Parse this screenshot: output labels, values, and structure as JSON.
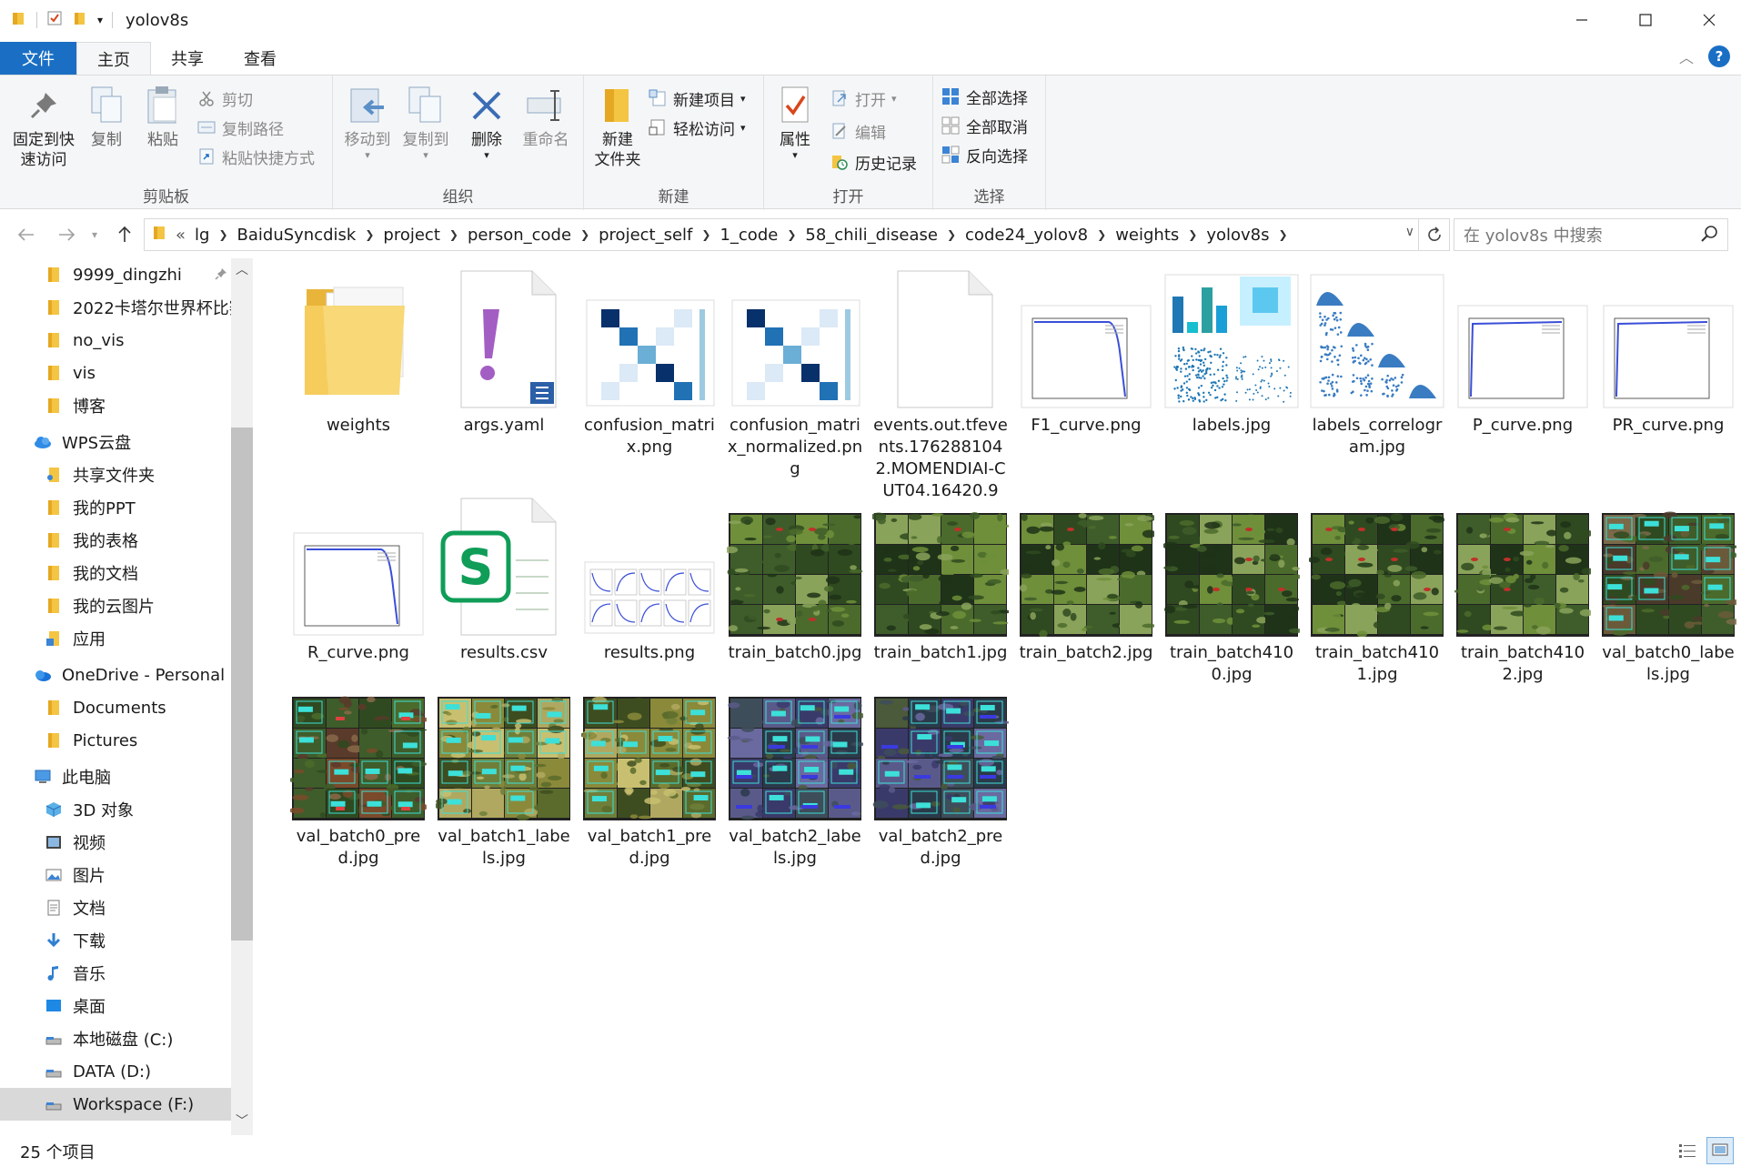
{
  "window": {
    "title": "yolov8s"
  },
  "ribbon_tabs": [
    "文件",
    "主页",
    "共享",
    "查看"
  ],
  "ribbon": {
    "clipboard": {
      "group": "剪贴板",
      "pin": "固定到快\n速访问",
      "copy": "复制",
      "paste": "粘贴",
      "cut": "剪切",
      "copy_path": "复制路径",
      "paste_shortcut": "粘贴快捷方式"
    },
    "organize": {
      "group": "组织",
      "move_to": "移动到",
      "copy_to": "复制到",
      "delete": "删除",
      "rename": "重命名"
    },
    "new": {
      "group": "新建",
      "new_folder": "新建\n文件夹",
      "new_item": "新建项目",
      "easy_access": "轻松访问"
    },
    "open": {
      "group": "打开",
      "properties": "属性",
      "open": "打开",
      "edit": "编辑",
      "history": "历史记录"
    },
    "select": {
      "group": "选择",
      "select_all": "全部选择",
      "select_none": "全部取消",
      "invert": "反向选择"
    }
  },
  "address": {
    "overflow": "«",
    "crumbs": [
      "lg",
      "BaiduSyncdisk",
      "project",
      "person_code",
      "project_self",
      "1_code",
      "58_chili_disease",
      "code24_yolov8",
      "weights",
      "yolov8s"
    ],
    "search_placeholder": "在 yolov8s 中搜索"
  },
  "nav": [
    {
      "label": "9999_dingzhi",
      "icon": "folder",
      "indent": 2,
      "pinned": true
    },
    {
      "label": "2022卡塔尔世界杯比赛",
      "icon": "folder",
      "indent": 2
    },
    {
      "label": "no_vis",
      "icon": "folder",
      "indent": 2
    },
    {
      "label": "vis",
      "icon": "folder",
      "indent": 2
    },
    {
      "label": "博客",
      "icon": "folder",
      "indent": 2
    },
    {
      "label": "WPS云盘",
      "icon": "cloud",
      "indent": 1,
      "gap": true
    },
    {
      "label": "共享文件夹",
      "icon": "shared-folder",
      "indent": 2
    },
    {
      "label": "我的PPT",
      "icon": "folder",
      "indent": 2
    },
    {
      "label": "我的表格",
      "icon": "folder",
      "indent": 2
    },
    {
      "label": "我的文档",
      "icon": "folder",
      "indent": 2
    },
    {
      "label": "我的云图片",
      "icon": "folder",
      "indent": 2
    },
    {
      "label": "应用",
      "icon": "apps-folder",
      "indent": 2
    },
    {
      "label": "OneDrive - Personal",
      "icon": "onedrive",
      "indent": 1,
      "gap": true
    },
    {
      "label": "Documents",
      "icon": "folder",
      "indent": 2
    },
    {
      "label": "Pictures",
      "icon": "folder",
      "indent": 2
    },
    {
      "label": "此电脑",
      "icon": "pc",
      "indent": 1,
      "gap": true
    },
    {
      "label": "3D 对象",
      "icon": "3d",
      "indent": 2
    },
    {
      "label": "视频",
      "icon": "video",
      "indent": 2
    },
    {
      "label": "图片",
      "icon": "picture",
      "indent": 2
    },
    {
      "label": "文档",
      "icon": "document",
      "indent": 2
    },
    {
      "label": "下载",
      "icon": "download",
      "indent": 2
    },
    {
      "label": "音乐",
      "icon": "music",
      "indent": 2
    },
    {
      "label": "桌面",
      "icon": "desktop",
      "indent": 2
    },
    {
      "label": "本地磁盘 (C:)",
      "icon": "drive",
      "indent": 2
    },
    {
      "label": "DATA (D:)",
      "icon": "drive",
      "indent": 2
    },
    {
      "label": "Workspace (F:)",
      "icon": "drive",
      "indent": 2,
      "selected": true
    }
  ],
  "files": [
    {
      "name": "weights",
      "kind": "folder"
    },
    {
      "name": "args.yaml",
      "kind": "yaml"
    },
    {
      "name": "confusion_matrix.png",
      "kind": "confusion"
    },
    {
      "name": "confusion_matrix_normalized.png",
      "kind": "confusion"
    },
    {
      "name": "events.out.tfevents.1762881042.MOMENDIAI-CUT04.16420.9",
      "kind": "blank"
    },
    {
      "name": "F1_curve.png",
      "kind": "curve-down"
    },
    {
      "name": "labels.jpg",
      "kind": "labels"
    },
    {
      "name": "labels_correlogram.jpg",
      "kind": "correlogram"
    },
    {
      "name": "P_curve.png",
      "kind": "curve-flat"
    },
    {
      "name": "PR_curve.png",
      "kind": "curve-flat"
    },
    {
      "name": "R_curve.png",
      "kind": "curve-down"
    },
    {
      "name": "results.csv",
      "kind": "csv"
    },
    {
      "name": "results.png",
      "kind": "results"
    },
    {
      "name": "train_batch0.jpg",
      "kind": "photo",
      "palette": "green"
    },
    {
      "name": "train_batch1.jpg",
      "kind": "photo",
      "palette": "green"
    },
    {
      "name": "train_batch2.jpg",
      "kind": "photo",
      "palette": "green"
    },
    {
      "name": "train_batch4100.jpg",
      "kind": "photo",
      "palette": "green"
    },
    {
      "name": "train_batch4101.jpg",
      "kind": "photo",
      "palette": "green"
    },
    {
      "name": "train_batch4102.jpg",
      "kind": "photo",
      "palette": "green"
    },
    {
      "name": "val_batch0_labels.jpg",
      "kind": "photo",
      "palette": "labeled"
    },
    {
      "name": "val_batch0_pred.jpg",
      "kind": "photo",
      "palette": "labeled-red"
    },
    {
      "name": "val_batch1_labels.jpg",
      "kind": "photo",
      "palette": "yellow"
    },
    {
      "name": "val_batch1_pred.jpg",
      "kind": "photo",
      "palette": "yellow"
    },
    {
      "name": "val_batch2_labels.jpg",
      "kind": "photo",
      "palette": "blue"
    },
    {
      "name": "val_batch2_pred.jpg",
      "kind": "photo",
      "palette": "blue"
    }
  ],
  "status": {
    "count": "25 个项目"
  },
  "colors": {
    "accent": "#1a6fc4",
    "folder": "#f4c542",
    "wps_green": "#0f9d58",
    "chart_blue": "#3b4fd8"
  }
}
